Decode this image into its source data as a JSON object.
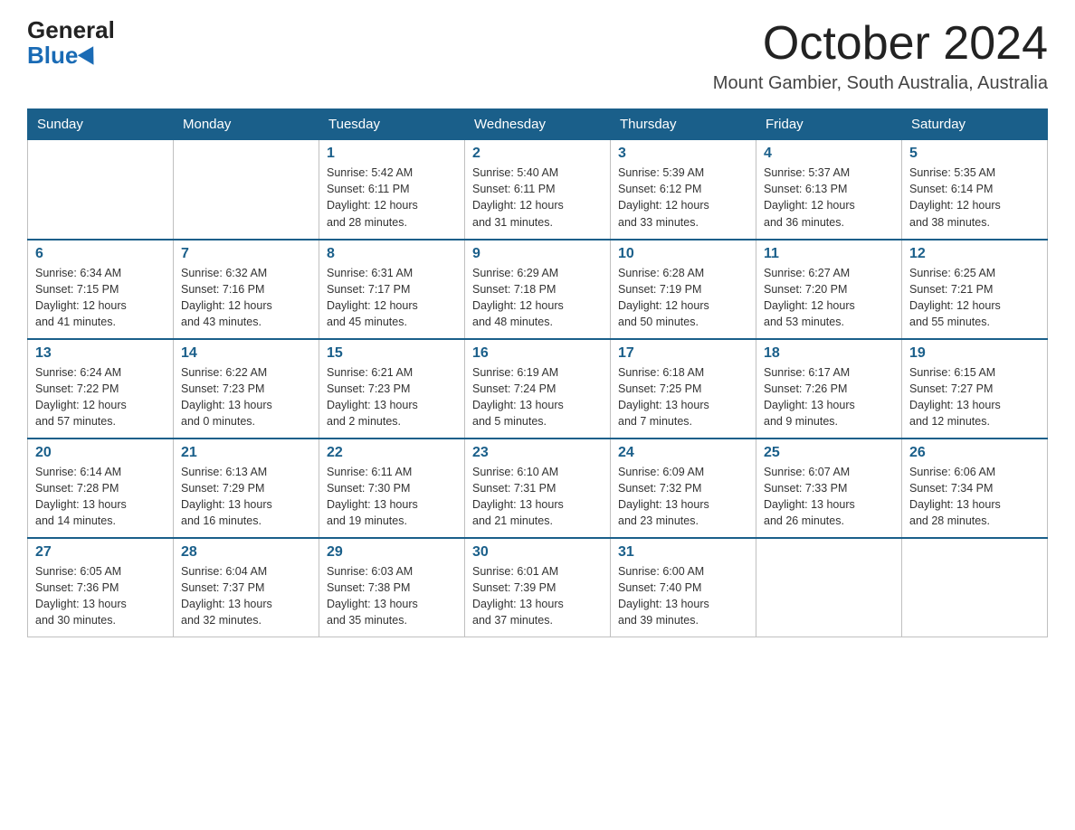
{
  "logo": {
    "general": "General",
    "blue": "Blue"
  },
  "title": "October 2024",
  "location": "Mount Gambier, South Australia, Australia",
  "weekdays": [
    "Sunday",
    "Monday",
    "Tuesday",
    "Wednesday",
    "Thursday",
    "Friday",
    "Saturday"
  ],
  "weeks": [
    [
      {
        "day": "",
        "info": ""
      },
      {
        "day": "",
        "info": ""
      },
      {
        "day": "1",
        "info": "Sunrise: 5:42 AM\nSunset: 6:11 PM\nDaylight: 12 hours\nand 28 minutes."
      },
      {
        "day": "2",
        "info": "Sunrise: 5:40 AM\nSunset: 6:11 PM\nDaylight: 12 hours\nand 31 minutes."
      },
      {
        "day": "3",
        "info": "Sunrise: 5:39 AM\nSunset: 6:12 PM\nDaylight: 12 hours\nand 33 minutes."
      },
      {
        "day": "4",
        "info": "Sunrise: 5:37 AM\nSunset: 6:13 PM\nDaylight: 12 hours\nand 36 minutes."
      },
      {
        "day": "5",
        "info": "Sunrise: 5:35 AM\nSunset: 6:14 PM\nDaylight: 12 hours\nand 38 minutes."
      }
    ],
    [
      {
        "day": "6",
        "info": "Sunrise: 6:34 AM\nSunset: 7:15 PM\nDaylight: 12 hours\nand 41 minutes."
      },
      {
        "day": "7",
        "info": "Sunrise: 6:32 AM\nSunset: 7:16 PM\nDaylight: 12 hours\nand 43 minutes."
      },
      {
        "day": "8",
        "info": "Sunrise: 6:31 AM\nSunset: 7:17 PM\nDaylight: 12 hours\nand 45 minutes."
      },
      {
        "day": "9",
        "info": "Sunrise: 6:29 AM\nSunset: 7:18 PM\nDaylight: 12 hours\nand 48 minutes."
      },
      {
        "day": "10",
        "info": "Sunrise: 6:28 AM\nSunset: 7:19 PM\nDaylight: 12 hours\nand 50 minutes."
      },
      {
        "day": "11",
        "info": "Sunrise: 6:27 AM\nSunset: 7:20 PM\nDaylight: 12 hours\nand 53 minutes."
      },
      {
        "day": "12",
        "info": "Sunrise: 6:25 AM\nSunset: 7:21 PM\nDaylight: 12 hours\nand 55 minutes."
      }
    ],
    [
      {
        "day": "13",
        "info": "Sunrise: 6:24 AM\nSunset: 7:22 PM\nDaylight: 12 hours\nand 57 minutes."
      },
      {
        "day": "14",
        "info": "Sunrise: 6:22 AM\nSunset: 7:23 PM\nDaylight: 13 hours\nand 0 minutes."
      },
      {
        "day": "15",
        "info": "Sunrise: 6:21 AM\nSunset: 7:23 PM\nDaylight: 13 hours\nand 2 minutes."
      },
      {
        "day": "16",
        "info": "Sunrise: 6:19 AM\nSunset: 7:24 PM\nDaylight: 13 hours\nand 5 minutes."
      },
      {
        "day": "17",
        "info": "Sunrise: 6:18 AM\nSunset: 7:25 PM\nDaylight: 13 hours\nand 7 minutes."
      },
      {
        "day": "18",
        "info": "Sunrise: 6:17 AM\nSunset: 7:26 PM\nDaylight: 13 hours\nand 9 minutes."
      },
      {
        "day": "19",
        "info": "Sunrise: 6:15 AM\nSunset: 7:27 PM\nDaylight: 13 hours\nand 12 minutes."
      }
    ],
    [
      {
        "day": "20",
        "info": "Sunrise: 6:14 AM\nSunset: 7:28 PM\nDaylight: 13 hours\nand 14 minutes."
      },
      {
        "day": "21",
        "info": "Sunrise: 6:13 AM\nSunset: 7:29 PM\nDaylight: 13 hours\nand 16 minutes."
      },
      {
        "day": "22",
        "info": "Sunrise: 6:11 AM\nSunset: 7:30 PM\nDaylight: 13 hours\nand 19 minutes."
      },
      {
        "day": "23",
        "info": "Sunrise: 6:10 AM\nSunset: 7:31 PM\nDaylight: 13 hours\nand 21 minutes."
      },
      {
        "day": "24",
        "info": "Sunrise: 6:09 AM\nSunset: 7:32 PM\nDaylight: 13 hours\nand 23 minutes."
      },
      {
        "day": "25",
        "info": "Sunrise: 6:07 AM\nSunset: 7:33 PM\nDaylight: 13 hours\nand 26 minutes."
      },
      {
        "day": "26",
        "info": "Sunrise: 6:06 AM\nSunset: 7:34 PM\nDaylight: 13 hours\nand 28 minutes."
      }
    ],
    [
      {
        "day": "27",
        "info": "Sunrise: 6:05 AM\nSunset: 7:36 PM\nDaylight: 13 hours\nand 30 minutes."
      },
      {
        "day": "28",
        "info": "Sunrise: 6:04 AM\nSunset: 7:37 PM\nDaylight: 13 hours\nand 32 minutes."
      },
      {
        "day": "29",
        "info": "Sunrise: 6:03 AM\nSunset: 7:38 PM\nDaylight: 13 hours\nand 35 minutes."
      },
      {
        "day": "30",
        "info": "Sunrise: 6:01 AM\nSunset: 7:39 PM\nDaylight: 13 hours\nand 37 minutes."
      },
      {
        "day": "31",
        "info": "Sunrise: 6:00 AM\nSunset: 7:40 PM\nDaylight: 13 hours\nand 39 minutes."
      },
      {
        "day": "",
        "info": ""
      },
      {
        "day": "",
        "info": ""
      }
    ]
  ]
}
